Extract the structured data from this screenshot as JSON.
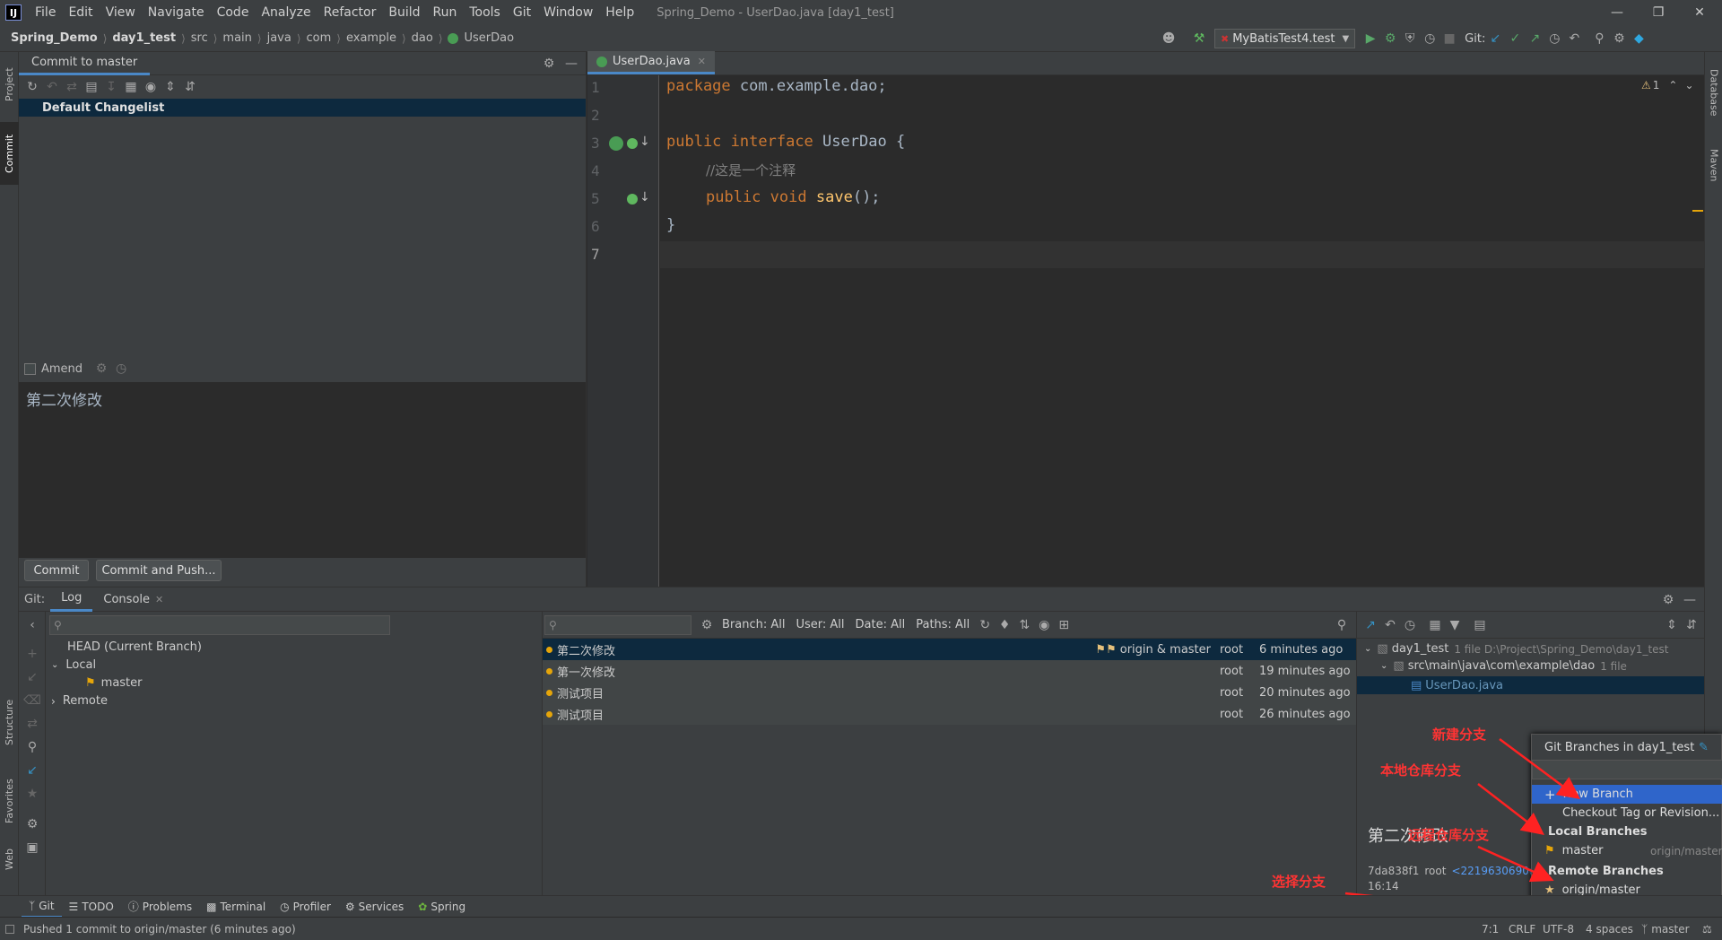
{
  "app": {
    "window_title": "Spring_Demo - UserDao.java [day1_test]",
    "menu": [
      "File",
      "Edit",
      "View",
      "Navigate",
      "Code",
      "Analyze",
      "Refactor",
      "Build",
      "Run",
      "Tools",
      "Git",
      "Window",
      "Help"
    ]
  },
  "breadcrumb": [
    "Spring_Demo",
    "day1_test",
    "src",
    "main",
    "java",
    "com",
    "example",
    "dao",
    "UserDao"
  ],
  "toolbar": {
    "run_config": "MyBatisTest4.test",
    "git_label": "Git:"
  },
  "left_strip": {
    "project": "Project",
    "commit": "Commit",
    "structure": "Structure",
    "favorites": "Favorites",
    "web": "Web"
  },
  "right_strip": {
    "database": "Database",
    "maven": "Maven"
  },
  "commit_panel": {
    "tab": "Commit to master",
    "changelist": "Default Changelist",
    "amend_label": "Amend",
    "message": "第二次修改",
    "commit_button": "Commit",
    "commit_push_button": "Commit and Push..."
  },
  "editor": {
    "tab": "UserDao.java",
    "warning_count": "1",
    "line_numbers": [
      "1",
      "2",
      "3",
      "4",
      "5",
      "6",
      "7"
    ],
    "code": {
      "l1_kw": "package",
      "l1_rest": " com.example.dao;",
      "l3_kw1": "public",
      "l3_kw2": "interface",
      "l3_name": "UserDao",
      "l3_brace": " {",
      "l4_comment": "//这是一个注释",
      "l5_kw1": "public",
      "l5_kw2": "void",
      "l5_fn": "save",
      "l5_rest": "();",
      "l6": "}"
    }
  },
  "git_tool": {
    "label": "Git:",
    "tabs": [
      "Log",
      "Console"
    ],
    "branches_tree": {
      "head": "HEAD (Current Branch)",
      "local": "Local",
      "master": "master",
      "remote": "Remote"
    },
    "filters": [
      "Branch: All",
      "User: All",
      "Date: All",
      "Paths: All"
    ],
    "commits": [
      {
        "subject": "第二次修改",
        "refs": "origin & master",
        "author": "root",
        "date": "6 minutes ago"
      },
      {
        "subject": "第一次修改",
        "refs": "",
        "author": "root",
        "date": "19 minutes ago"
      },
      {
        "subject": "测试项目",
        "refs": "",
        "author": "root",
        "date": "20 minutes ago"
      },
      {
        "subject": "测试项目",
        "refs": "",
        "author": "root",
        "date": "26 minutes ago"
      }
    ],
    "changes_tree": {
      "root": "day1_test",
      "root_meta": "1 file  D:\\Project\\Spring_Demo\\day1_test",
      "folder": "src\\main\\java\\com\\example\\dao",
      "folder_meta": "1 file",
      "file": "UserDao.java"
    },
    "detail": {
      "title": "第二次修改",
      "hash": "7da838f1",
      "author": "root",
      "email": "<2219630690@",
      "time": "16:14"
    }
  },
  "branches_popup": {
    "title": "Git Branches in day1_test",
    "new_branch": "New Branch",
    "checkout": "Checkout Tag or Revision...",
    "local_header": "Local Branches",
    "local_master": "master",
    "local_master_tracking": "origin/master",
    "remote_header": "Remote Branches",
    "remote_master": "origin/master"
  },
  "annotations": {
    "new_branch": "新建分支",
    "local_repo": "本地仓库分支",
    "remote_repo": "远程仓库分支",
    "select": "选择分支"
  },
  "bottom_tools": [
    "Git",
    "TODO",
    "Problems",
    "Terminal",
    "Profiler",
    "Services",
    "Spring"
  ],
  "status": {
    "message": "Pushed 1 commit to origin/master (6 minutes ago)",
    "position": "7:1",
    "line_sep": "CRLF",
    "encoding": "UTF-8",
    "indent": "4 spaces",
    "branch": "master"
  }
}
